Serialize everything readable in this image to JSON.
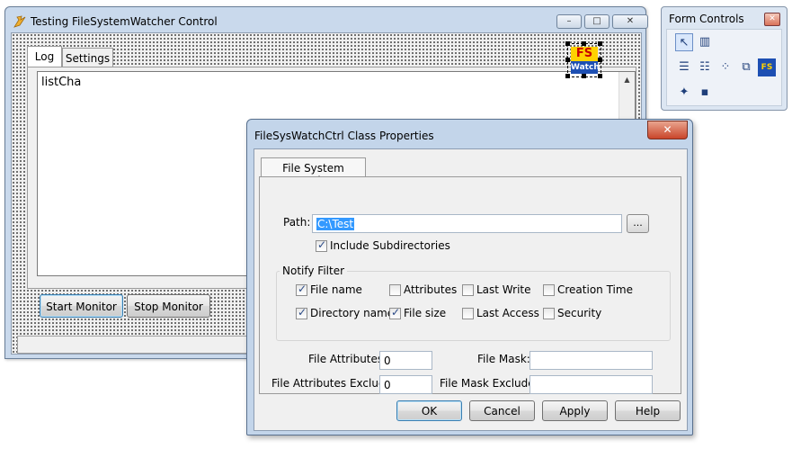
{
  "main_window": {
    "title": "Testing FileSystemWatcher Control",
    "caption_minimize": "–",
    "caption_maximize": "□",
    "caption_close": "✕",
    "tabs": [
      {
        "label": "Log"
      },
      {
        "label": "Settings"
      }
    ],
    "list_text": "listCha",
    "scroll_up": "▲",
    "buttons": {
      "start": "Start Monitor",
      "stop": "Stop Monitor"
    },
    "fswatch_logo": {
      "top": "FS",
      "bottom": "Watch"
    }
  },
  "toolbox": {
    "title": "Form Controls",
    "close": "✕",
    "icons": [
      {
        "name": "pointer-icon",
        "glyph": "↖"
      },
      {
        "name": "books-icon",
        "glyph": "▥"
      },
      {
        "name": "listview-icon",
        "glyph": "☰"
      },
      {
        "name": "table-icon",
        "glyph": "☷"
      },
      {
        "name": "grid-icon",
        "glyph": "⁘"
      },
      {
        "name": "windows-icon",
        "glyph": "⧉"
      },
      {
        "name": "fswatch-icon",
        "glyph": "FS"
      },
      {
        "name": "wand-icon",
        "glyph": "✦"
      },
      {
        "name": "lock-icon",
        "glyph": "▪"
      }
    ]
  },
  "dialog": {
    "title": "FileSysWatchCtrl Class Properties",
    "close": "✕",
    "tab_label": "File System Watcher",
    "path_label": "Path:",
    "path_value": "C:\\Test",
    "browse_label": "...",
    "include_subdirs": {
      "label": "Include Subdirectories",
      "checked": true
    },
    "notify_filter": {
      "title": "Notify Filter",
      "items": [
        {
          "label": "File name",
          "checked": true
        },
        {
          "label": "Attributes",
          "checked": false
        },
        {
          "label": "Last Write",
          "checked": false
        },
        {
          "label": "Creation Time",
          "checked": false
        },
        {
          "label": "Directory name",
          "checked": true
        },
        {
          "label": "File size",
          "checked": true
        },
        {
          "label": "Last Access",
          "checked": false
        },
        {
          "label": "Security",
          "checked": false
        }
      ]
    },
    "file_attributes_label": "File Attributes:",
    "file_attributes_value": "0",
    "file_attributes_exclude_label": "File Attributes Exclude:",
    "file_attributes_exclude_value": "0",
    "file_mask_label": "File Mask:",
    "file_mask_value": "",
    "file_mask_exclude_label": "File Mask Exclude:",
    "file_mask_exclude_value": "",
    "buttons": {
      "ok": "OK",
      "cancel": "Cancel",
      "apply": "Apply",
      "help": "Help"
    }
  }
}
